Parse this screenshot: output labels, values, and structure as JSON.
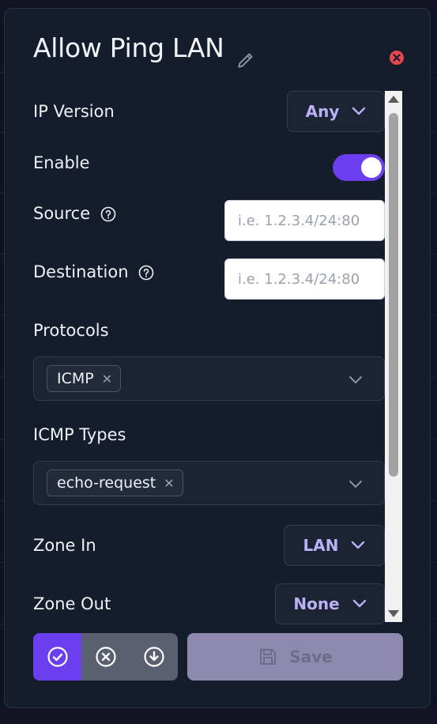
{
  "modal": {
    "title": "Allow Ping LAN"
  },
  "form": {
    "ip_version": {
      "label": "IP Version",
      "value": "Any"
    },
    "enable": {
      "label": "Enable",
      "checked": true
    },
    "source": {
      "label": "Source",
      "placeholder": "i.e. 1.2.3.4/24:80",
      "value": ""
    },
    "destination": {
      "label": "Destination",
      "placeholder": "i.e. 1.2.3.4/24:80",
      "value": ""
    },
    "protocols": {
      "label": "Protocols",
      "selected": [
        "ICMP"
      ]
    },
    "icmp_types": {
      "label": "ICMP Types",
      "selected": [
        "echo-request"
      ]
    },
    "zone_in": {
      "label": "Zone In",
      "value": "LAN"
    },
    "zone_out": {
      "label": "Zone Out",
      "value": "None"
    }
  },
  "footer": {
    "save_label": "Save",
    "icons": [
      "check-circle-icon",
      "x-circle-icon",
      "download-circle-icon",
      "save-icon"
    ]
  },
  "colors": {
    "accent": "#6b3ff0",
    "close": "#e5484d",
    "dropdown_text": "#b9b0f5"
  }
}
